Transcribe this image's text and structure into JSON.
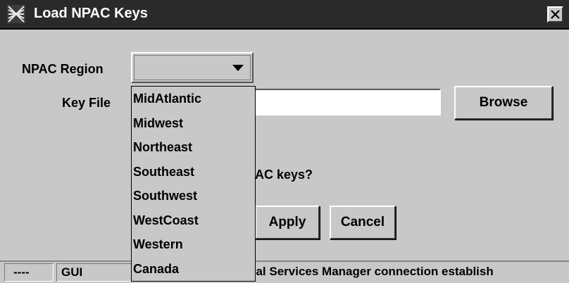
{
  "window": {
    "title": "Load NPAC Keys",
    "icon": "app-window-icon",
    "close_icon": "close-icon"
  },
  "form": {
    "region_label": "NPAC Region",
    "region_selected": "",
    "keyfile_label": "Key File",
    "keyfile_value": "",
    "browse_label": "Browse",
    "question_visible": "AC keys?",
    "apply_label": "Apply",
    "cancel_label": "Cancel"
  },
  "dropdown": {
    "options": [
      "MidAtlantic",
      "Midwest",
      "Northeast",
      "Southeast",
      "Southwest",
      "WestCoast",
      "Western",
      "Canada"
    ]
  },
  "status": {
    "cell_a": "----",
    "cell_b": "GUI",
    "message_visible": "cal Services Manager connection establish"
  }
}
